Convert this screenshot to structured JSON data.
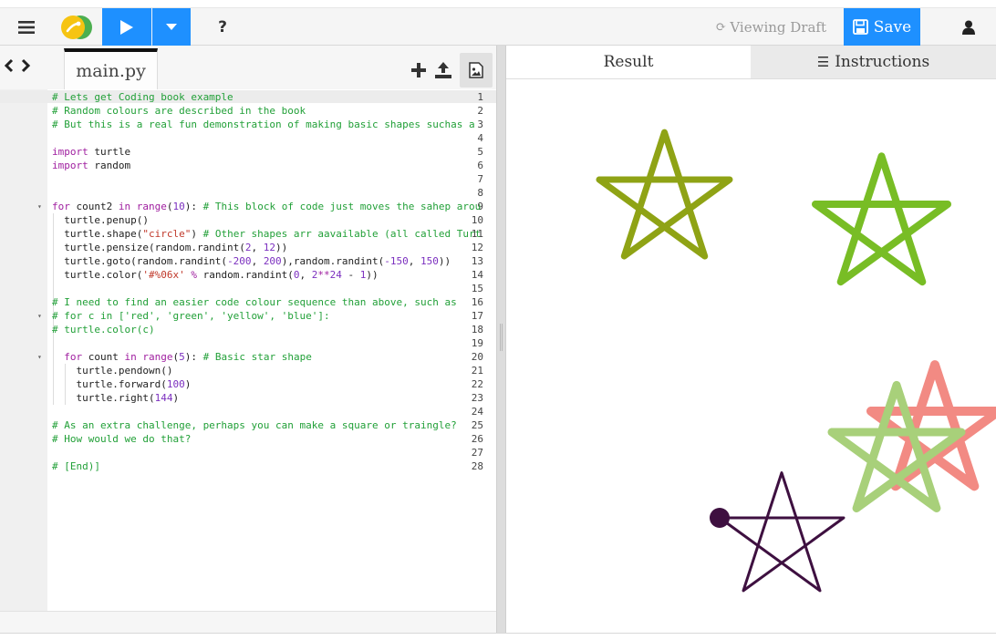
{
  "toolbar": {
    "help_label": "?",
    "draft_icon": "refresh-icon",
    "draft_label": "Viewing Draft",
    "save_label": "Save",
    "colors": {
      "accent": "#1e90ff",
      "logo_yellow": "#f6c412",
      "logo_green": "#4caf50"
    }
  },
  "editor": {
    "file_tab": "main.py",
    "line_numbers": [
      "1",
      "2",
      "3",
      "4",
      "5",
      "6",
      "7",
      "8",
      "9",
      "10",
      "11",
      "12",
      "13",
      "14",
      "15",
      "16",
      "17",
      "18",
      "19",
      "20",
      "21",
      "22",
      "23",
      "24",
      "25",
      "26",
      "27",
      "28"
    ],
    "fold_markers": {
      "9": "▾",
      "17": "▾",
      "20": "▾"
    },
    "lines": [
      [
        [
          "c",
          "# Lets get Coding book example"
        ]
      ],
      [
        [
          "c",
          "# Random colours are described in the book"
        ]
      ],
      [
        [
          "c",
          "# But this is a real fun demonstration of making basic shapes suchas a"
        ]
      ],
      [],
      [
        [
          "k",
          "import"
        ],
        [
          "p",
          " turtle"
        ]
      ],
      [
        [
          "k",
          "import"
        ],
        [
          "p",
          " random"
        ]
      ],
      [],
      [],
      [
        [
          "k",
          "for"
        ],
        [
          "p",
          " count2 "
        ],
        [
          "k",
          "in"
        ],
        [
          "p",
          " "
        ],
        [
          "k",
          "range"
        ],
        [
          "p",
          "("
        ],
        [
          "n",
          "10"
        ],
        [
          "p",
          "): "
        ],
        [
          "c",
          "# This block of code just moves the sahep arou"
        ]
      ],
      [
        [
          "p",
          "  turtle.penup()"
        ]
      ],
      [
        [
          "p",
          "  turtle.shape("
        ],
        [
          "s",
          "\"circle\""
        ],
        [
          "p",
          ") "
        ],
        [
          "c",
          "# Other shapes arr aavailable (all called Turt"
        ]
      ],
      [
        [
          "p",
          "  turtle.pensize(random.randint("
        ],
        [
          "n",
          "2"
        ],
        [
          "p",
          ", "
        ],
        [
          "n",
          "12"
        ],
        [
          "p",
          "))"
        ]
      ],
      [
        [
          "p",
          "  turtle.goto(random.randint("
        ],
        [
          "n",
          "-200"
        ],
        [
          "p",
          ", "
        ],
        [
          "n",
          "200"
        ],
        [
          "p",
          "),random.randint("
        ],
        [
          "n",
          "-150"
        ],
        [
          "p",
          ", "
        ],
        [
          "n",
          "150"
        ],
        [
          "p",
          "))"
        ]
      ],
      [
        [
          "p",
          "  turtle.color("
        ],
        [
          "s",
          "'#%06x'"
        ],
        [
          "p",
          " "
        ],
        [
          "k",
          "%"
        ],
        [
          "p",
          " random.randint("
        ],
        [
          "n",
          "0"
        ],
        [
          "p",
          ", "
        ],
        [
          "n",
          "2"
        ],
        [
          "k",
          "**"
        ],
        [
          "n",
          "24"
        ],
        [
          "p",
          " - "
        ],
        [
          "n",
          "1"
        ],
        [
          "p",
          "))"
        ]
      ],
      [],
      [
        [
          "c",
          "# I need to find an easier code colour sequence than above, such as"
        ]
      ],
      [
        [
          "c",
          "# for c in ['red', 'green', 'yellow', 'blue']:"
        ]
      ],
      [
        [
          "c",
          "# turtle.color(c)"
        ]
      ],
      [],
      [
        [
          "p",
          "  "
        ],
        [
          "k",
          "for"
        ],
        [
          "p",
          " count "
        ],
        [
          "k",
          "in"
        ],
        [
          "p",
          " "
        ],
        [
          "k",
          "range"
        ],
        [
          "p",
          "("
        ],
        [
          "n",
          "5"
        ],
        [
          "p",
          "): "
        ],
        [
          "c",
          "# Basic star shape"
        ]
      ],
      [
        [
          "p",
          "    turtle.pendown()"
        ]
      ],
      [
        [
          "p",
          "    turtle.forward("
        ],
        [
          "n",
          "100"
        ],
        [
          "p",
          ")"
        ]
      ],
      [
        [
          "p",
          "    turtle.right("
        ],
        [
          "n",
          "144"
        ],
        [
          "p",
          ")"
        ]
      ],
      [],
      [
        [
          "c",
          "# As an extra challenge, perhaps you can make a square or traingle?"
        ]
      ],
      [
        [
          "c",
          "# How would we do that?"
        ]
      ],
      [],
      [
        [
          "c",
          "# [End)]"
        ]
      ]
    ]
  },
  "output": {
    "tab_result": "Result",
    "tab_instructions_icon": "list-icon",
    "tab_instructions": "Instructions",
    "stars": [
      {
        "color": "#8fa315",
        "pensize": 7
      },
      {
        "color": "#78bd25",
        "pensize": 8
      },
      {
        "color": "#f28a83",
        "pensize": 10
      },
      {
        "color": "#a8d07a",
        "pensize": 9
      },
      {
        "color": "#3e1040",
        "pensize": 3
      }
    ],
    "turtle_color": "#3e1040"
  }
}
